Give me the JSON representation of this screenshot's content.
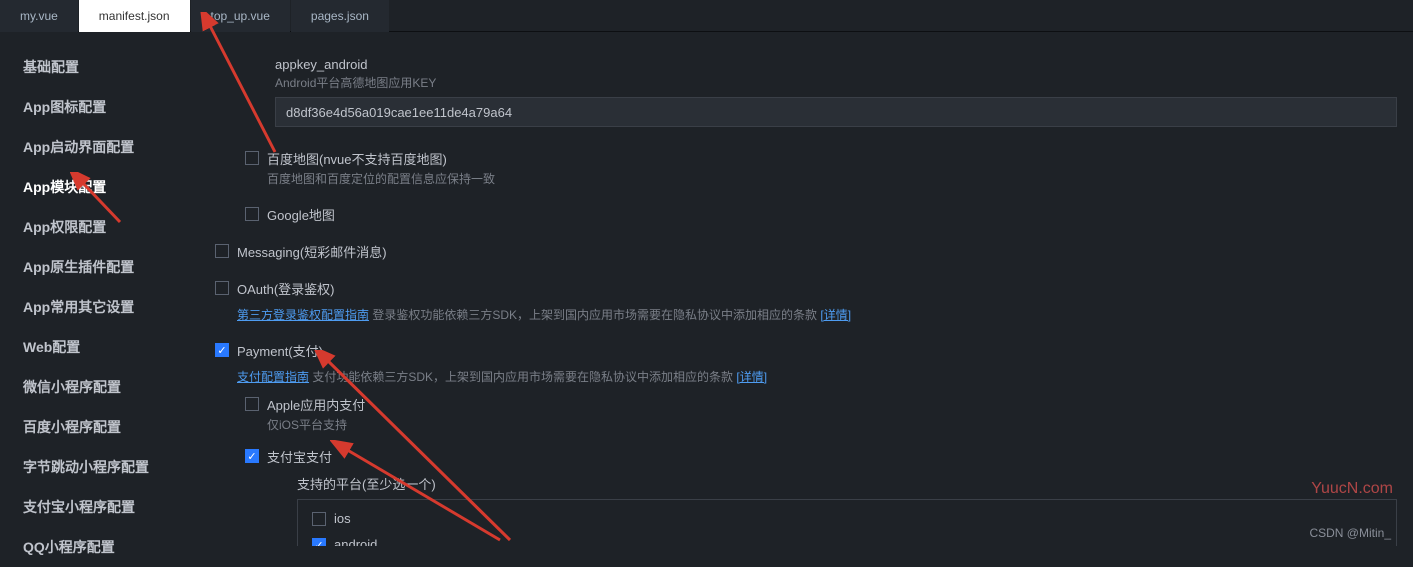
{
  "tabs": [
    {
      "label": "my.vue",
      "active": false
    },
    {
      "label": "manifest.json",
      "active": true
    },
    {
      "label": "top_up.vue",
      "active": false
    },
    {
      "label": "pages.json",
      "active": false
    }
  ],
  "sidebar": {
    "items": [
      {
        "label": "基础配置"
      },
      {
        "label": "App图标配置"
      },
      {
        "label": "App启动界面配置"
      },
      {
        "label": "App模块配置",
        "active": true
      },
      {
        "label": "App权限配置"
      },
      {
        "label": "App原生插件配置"
      },
      {
        "label": "App常用其它设置"
      },
      {
        "label": "Web配置"
      },
      {
        "label": "微信小程序配置"
      },
      {
        "label": "百度小程序配置"
      },
      {
        "label": "字节跳动小程序配置"
      },
      {
        "label": "支付宝小程序配置"
      },
      {
        "label": "QQ小程序配置"
      }
    ]
  },
  "appkey": {
    "label": "appkey_android",
    "hint": "Android平台高德地图应用KEY",
    "value": "d8df36e4d56a019cae1ee11de4a79a64"
  },
  "maps": {
    "baidu": {
      "label": "百度地图(nvue不支持百度地图)",
      "hint": "百度地图和百度定位的配置信息应保持一致"
    },
    "google": {
      "label": "Google地图"
    }
  },
  "messaging": {
    "label": "Messaging(短彩邮件消息)"
  },
  "oauth": {
    "label": "OAuth(登录鉴权)",
    "link": "第三方登录鉴权配置指南",
    "desc": " 登录鉴权功能依赖三方SDK，上架到国内应用市场需要在隐私协议中添加相应的条款 ",
    "detail": "[详情]"
  },
  "payment": {
    "label": "Payment(支付)",
    "link": "支付配置指南",
    "desc": " 支付功能依赖三方SDK，上架到国内应用市场需要在隐私协议中添加相应的条款 ",
    "detail": "[详情]",
    "apple": {
      "label": "Apple应用内支付",
      "hint": "仅iOS平台支持"
    },
    "alipay": {
      "label": "支付宝支付",
      "platform_label": "支持的平台(至少选一个)",
      "ios": "ios",
      "android": "android"
    }
  },
  "watermark": {
    "site": "YuucN.com",
    "author": "CSDN @Mitin_"
  }
}
